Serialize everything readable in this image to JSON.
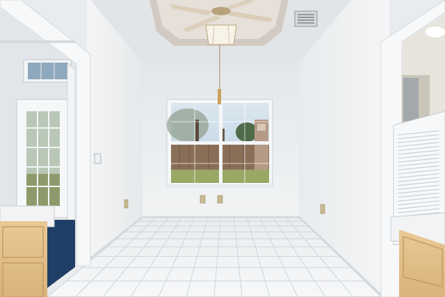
{
  "scene": {
    "kind": "interior-photo",
    "colors": {
      "wall": "#eef0f1",
      "wall_shade": "#dfe3e6",
      "ceiling": "#e4e6e8",
      "floor_tile": "#f3f4f5",
      "grout": "#cfd4d8",
      "cabinet": "#e6c48f",
      "cabinet_dark": "#c9a36a",
      "carpet": "#1f3f66",
      "sky": "#c9dbe8",
      "grass": "#9aa866",
      "fence": "#8a6f58"
    }
  }
}
